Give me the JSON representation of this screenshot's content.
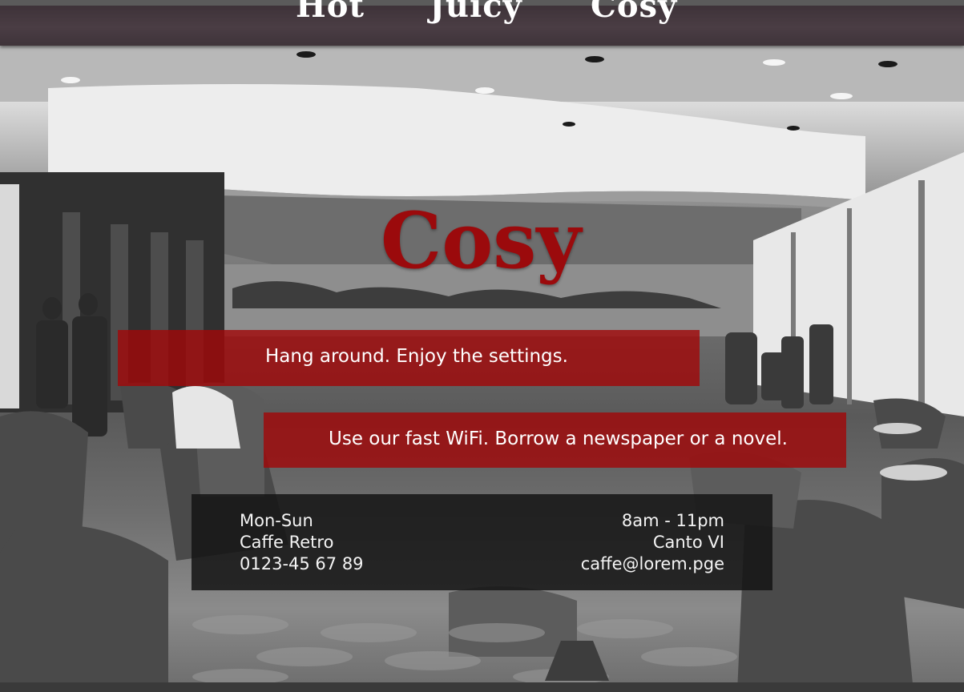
{
  "nav": {
    "items": [
      {
        "label": "Hot"
      },
      {
        "label": "Juicy"
      },
      {
        "label": "Cosy"
      }
    ]
  },
  "hero": {
    "title": "Cosy"
  },
  "bands": {
    "first": "Hang around. Enjoy the settings.",
    "second": "Use our fast WiFi. Borrow a newspaper or a novel."
  },
  "info": {
    "days": "Mon-Sun",
    "name": "Caffe Retro",
    "phone": "0123-45 67 89",
    "hours": "8am - 11pm",
    "address": "Canto VI",
    "email": "caffe@lorem.pge"
  },
  "colors": {
    "accent": "#9b0a0c",
    "band": "#a0080a",
    "topbar": "#43383e",
    "infobox": "#141414"
  }
}
